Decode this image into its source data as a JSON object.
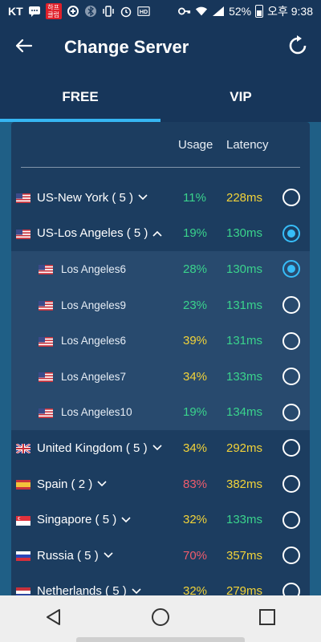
{
  "status_bar": {
    "carrier": "KT",
    "badge_text": "하프\n클럽",
    "battery": "52%",
    "time": "오후 9:38",
    "icons": [
      "message-icon",
      "app-badge-icon",
      "data-saver-icon",
      "bluetooth-icon",
      "vibrate-icon",
      "alarm-icon",
      "hd-icon",
      "key-icon",
      "wifi-icon",
      "signal-icon",
      "battery-icon"
    ]
  },
  "app_bar": {
    "title": "Change Server",
    "back_icon": "back-arrow-icon",
    "refresh_icon": "refresh-icon"
  },
  "tabs": [
    {
      "label": "FREE",
      "active": true
    },
    {
      "label": "VIP",
      "active": false
    }
  ],
  "list": {
    "headers": {
      "usage": "Usage",
      "latency": "Latency"
    },
    "rows": [
      {
        "name": "US-New York ( 5 )",
        "flag": "us",
        "expand": "down",
        "usage": "11%",
        "usage_color": "green",
        "latency": "228ms",
        "latency_color": "yellow",
        "selected": false,
        "sub": false
      },
      {
        "name": "US-Los Angeles ( 5 )",
        "flag": "us",
        "expand": "up",
        "usage": "19%",
        "usage_color": "green",
        "latency": "130ms",
        "latency_color": "green",
        "selected": true,
        "sub": false
      },
      {
        "name": "Los Angeles6",
        "flag": "us",
        "expand": "",
        "usage": "28%",
        "usage_color": "green",
        "latency": "130ms",
        "latency_color": "green",
        "selected": true,
        "sub": true
      },
      {
        "name": "Los Angeles9",
        "flag": "us",
        "expand": "",
        "usage": "23%",
        "usage_color": "green",
        "latency": "131ms",
        "latency_color": "green",
        "selected": false,
        "sub": true
      },
      {
        "name": "Los Angeles6",
        "flag": "us",
        "expand": "",
        "usage": "39%",
        "usage_color": "yellow",
        "latency": "131ms",
        "latency_color": "green",
        "selected": false,
        "sub": true
      },
      {
        "name": "Los Angeles7",
        "flag": "us",
        "expand": "",
        "usage": "34%",
        "usage_color": "yellow",
        "latency": "133ms",
        "latency_color": "green",
        "selected": false,
        "sub": true
      },
      {
        "name": "Los Angeles10",
        "flag": "us",
        "expand": "",
        "usage": "19%",
        "usage_color": "green",
        "latency": "134ms",
        "latency_color": "green",
        "selected": false,
        "sub": true
      },
      {
        "name": "United Kingdom ( 5 )",
        "flag": "uk",
        "expand": "down",
        "usage": "34%",
        "usage_color": "yellow",
        "latency": "292ms",
        "latency_color": "yellow",
        "selected": false,
        "sub": false
      },
      {
        "name": "Spain ( 2 )",
        "flag": "es",
        "expand": "down",
        "usage": "83%",
        "usage_color": "red",
        "latency": "382ms",
        "latency_color": "yellow",
        "selected": false,
        "sub": false
      },
      {
        "name": "Singapore ( 5 )",
        "flag": "sg",
        "expand": "down",
        "usage": "32%",
        "usage_color": "yellow",
        "latency": "133ms",
        "latency_color": "green",
        "selected": false,
        "sub": false
      },
      {
        "name": "Russia ( 5 )",
        "flag": "ru",
        "expand": "down",
        "usage": "70%",
        "usage_color": "red",
        "latency": "357ms",
        "latency_color": "yellow",
        "selected": false,
        "sub": false
      },
      {
        "name": "Netherlands ( 5 )",
        "flag": "nl",
        "expand": "down",
        "usage": "32%",
        "usage_color": "yellow",
        "latency": "279ms",
        "latency_color": "yellow",
        "selected": false,
        "sub": false
      }
    ]
  },
  "nav_bar": {
    "buttons": [
      "back-triangle-icon",
      "home-circle-icon",
      "recents-square-icon"
    ]
  },
  "colors": {
    "green": "#3ad38c",
    "yellow": "#f2d339",
    "red": "#f05c6c",
    "accent": "#36b6f2"
  }
}
